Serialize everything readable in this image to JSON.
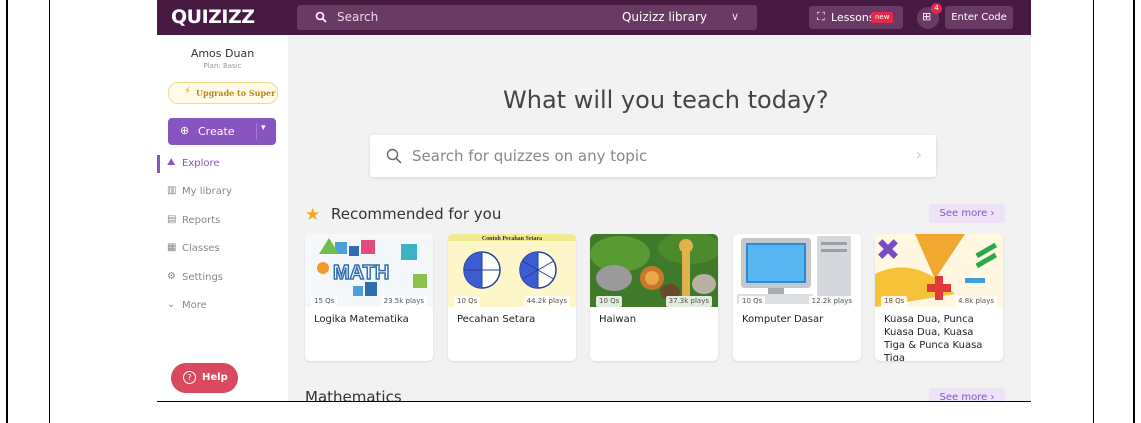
{
  "topbar": {
    "logo": "QUIZIZZ",
    "search_placeholder": "Search",
    "library_label": "Quizizz library",
    "lessons_label": "Lessons",
    "lessons_badge": "new",
    "gift_badge": "4",
    "enter_code_label": "Enter Code"
  },
  "sidebar": {
    "user_name": "Amos Duan",
    "user_plan": "Plan: Basic",
    "upgrade_label": "Upgrade to Super",
    "create_label": "Create",
    "items": [
      {
        "label": "Explore",
        "icon": "explore-icon",
        "active": true
      },
      {
        "label": "My library",
        "icon": "library-icon"
      },
      {
        "label": "Reports",
        "icon": "reports-icon"
      },
      {
        "label": "Classes",
        "icon": "classes-icon"
      },
      {
        "label": "Settings",
        "icon": "gear-icon"
      },
      {
        "label": "More",
        "icon": "chevron-down-icon"
      }
    ],
    "help_label": "Help"
  },
  "main": {
    "hero_title": "What will you teach today?",
    "search_placeholder": "Search for quizzes on any topic",
    "recommended": {
      "title": "Recommended for you",
      "see_more": "See more ›",
      "cards": [
        {
          "title": "Logika Matematika",
          "questions": "15 Qs",
          "plays": "23.5k plays",
          "thumb_text": "MATH"
        },
        {
          "title": "Pecahan Setara",
          "questions": "10 Qs",
          "plays": "44.2k plays",
          "thumb_text": "Contoh Pecahan Setara"
        },
        {
          "title": "Haiwan",
          "questions": "10 Qs",
          "plays": "37.3k plays"
        },
        {
          "title": "Komputer Dasar",
          "questions": "10 Qs",
          "plays": "12.2k plays"
        },
        {
          "title": "Kuasa Dua, Punca Kuasa Dua, Kuasa Tiga & Punca Kuasa Tiga",
          "questions": "18 Qs",
          "plays": "4.8k plays"
        }
      ]
    },
    "mathematics": {
      "title": "Mathematics",
      "see_more": "See more ›"
    }
  },
  "colors": {
    "topbar": "#461a42",
    "accent": "#8854c0",
    "help": "#d94a61",
    "new_badge": "#e8274b"
  }
}
